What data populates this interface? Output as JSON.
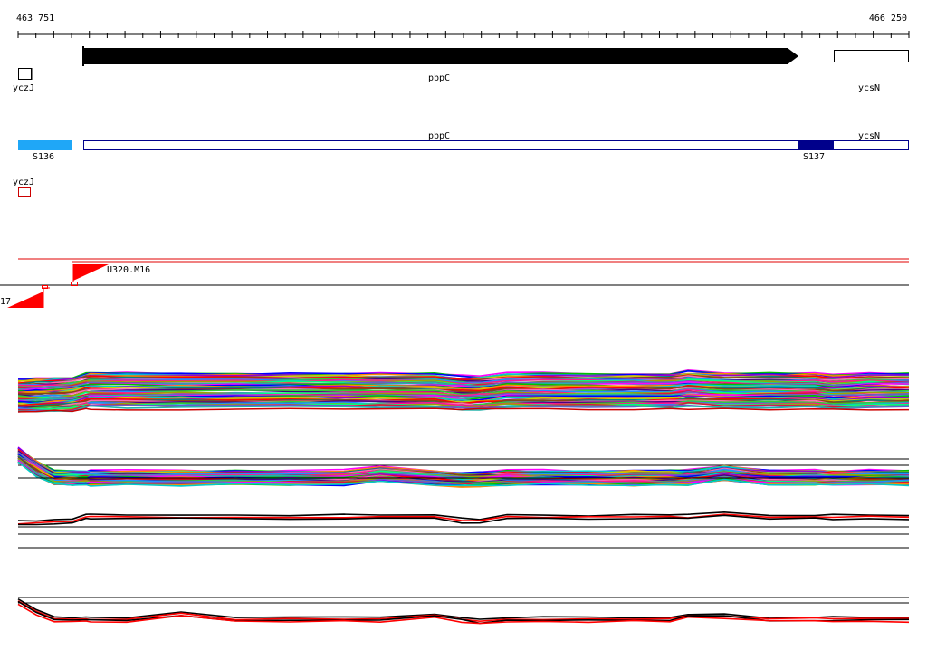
{
  "coords": {
    "start": "463 751",
    "end": "466 250"
  },
  "genes": {
    "yczJ": "yczJ",
    "pbpC": "pbpC",
    "ycsN": "ycsN"
  },
  "segments": {
    "pbpC": "pbpC",
    "ycsN": "ycsN",
    "s136": "S136",
    "s137": "S137"
  },
  "lower_gene": "yczJ",
  "markers": {
    "m16": "U320.M16",
    "m17": "17"
  },
  "colors": {
    "black": "#000000",
    "sky_blue": "#1fa7f7",
    "navy": "#00008b",
    "segment_outline": "#00008b",
    "red": "#ff0000",
    "dark_red": "#cc0000"
  }
}
